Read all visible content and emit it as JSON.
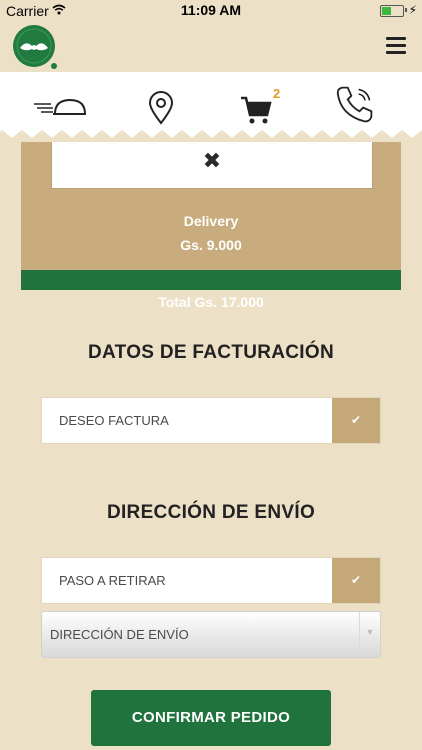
{
  "status_bar": {
    "carrier": "Carrier",
    "time": "11:09 AM",
    "battery_level": 0.45
  },
  "header": {
    "logo_icon": "mustache-logo-icon",
    "menu_icon": "hamburger-menu-icon"
  },
  "nav": {
    "items": [
      {
        "icon": "delivery-cloche-icon"
      },
      {
        "icon": "location-pin-icon"
      },
      {
        "icon": "cart-icon",
        "badge": "2"
      },
      {
        "icon": "phone-icon"
      }
    ]
  },
  "order_card": {
    "close_icon": "close-icon",
    "delivery_label": "Delivery",
    "delivery_price": "Gs. 9.000",
    "total": "Total Gs. 17.000"
  },
  "billing": {
    "title": "DATOS DE FACTURACIÓN",
    "invoice_label": "DESEO FACTURA"
  },
  "shipping": {
    "title": "DIRECCIÓN DE ENVÍO",
    "pickup_label": "PASO A RETIRAR",
    "address_select": "DIRECCIÓN DE ENVÍO"
  },
  "confirm_label": "CONFIRMAR PEDIDO",
  "colors": {
    "background": "#ece0c6",
    "accent_green": "#20733d",
    "tan": "#c8ac7d",
    "badge": "#e29a2d"
  }
}
